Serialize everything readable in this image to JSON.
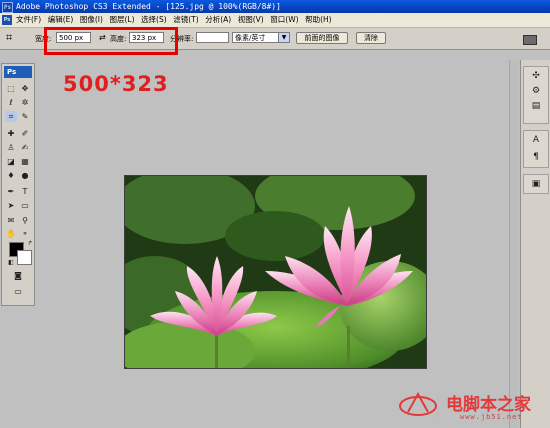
{
  "window": {
    "title": "Adobe Photoshop CS3 Extended - [125.jpg @ 100%(RGB/8#)]",
    "app_icon": "ps-app-icon"
  },
  "menu": {
    "items": [
      {
        "label": "文件(F)"
      },
      {
        "label": "编辑(E)"
      },
      {
        "label": "图像(I)"
      },
      {
        "label": "图层(L)"
      },
      {
        "label": "选择(S)"
      },
      {
        "label": "滤镜(T)"
      },
      {
        "label": "分析(A)"
      },
      {
        "label": "视图(V)"
      },
      {
        "label": "窗口(W)"
      },
      {
        "label": "帮助(H)"
      }
    ]
  },
  "options": {
    "width_label": "宽度:",
    "width_value": "500 px",
    "height_label": "高度:",
    "height_value": "323 px",
    "resolution_label": "分辨率:",
    "resolution_value": "",
    "units_value": "像素/英寸",
    "front_image_button": "前面的图像",
    "clear_button": "清除"
  },
  "annotation": {
    "text": "500*323",
    "color": "#e02020"
  },
  "toolbox": {
    "badge": "Ps"
  },
  "watermark": {
    "text": "电脚本之家",
    "url": "www.jb51.net"
  },
  "colors": {
    "titlebar": "#0745c4",
    "workspace": "#c0c0c0",
    "annotation": "#e60000"
  }
}
